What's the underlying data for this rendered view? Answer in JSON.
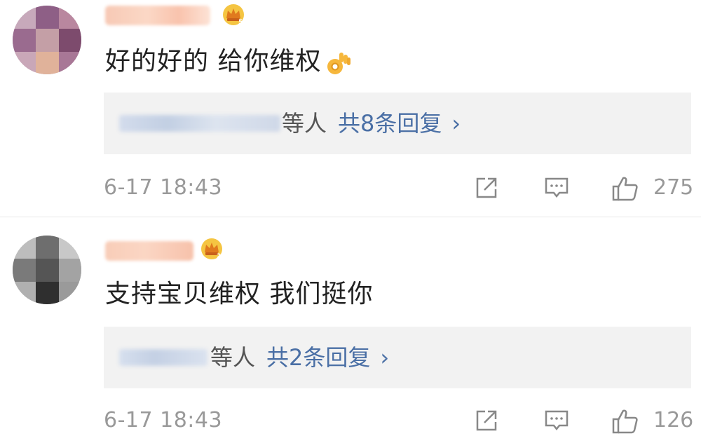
{
  "comments": [
    {
      "text": "好的好的 给你维权",
      "reply_prefix": "等人",
      "reply_count": "共8条回复",
      "reply_arrow": "›",
      "timestamp": "6-17 18:43",
      "likes": "275",
      "crown_icon": "crown-icon",
      "emoji_icon": "ok-hand-icon"
    },
    {
      "text": "支持宝贝维权 我们挺你",
      "reply_prefix": "等人",
      "reply_count": "共2条回复",
      "reply_arrow": "›",
      "timestamp": "6-17 18:43",
      "likes": "126",
      "crown_icon": "crown-icon"
    }
  ],
  "colors": {
    "link_blue": "#4a6fa5",
    "muted_gray": "#999999",
    "reply_bg": "#f2f2f2",
    "crown_gold": "#e8a317"
  }
}
